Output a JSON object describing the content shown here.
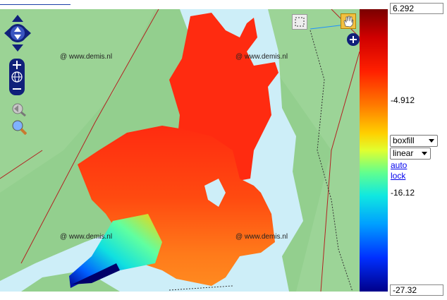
{
  "map": {
    "watermarks": [
      "@ www.demis.nl",
      "@ www.demis.nl",
      "@ www.demis.nl",
      "@ www.demis.nl"
    ],
    "tools": {
      "pan": "pan-arrows-icon",
      "zoom_in": "zoom-in-icon",
      "globe": "globe-icon",
      "zoom_out": "zoom-out-icon",
      "back": "back-arrow-icon",
      "zoom_box": "magnifier-icon",
      "select": "select-box-icon",
      "hand": "hand-icon",
      "expand": "plus-icon"
    }
  },
  "colorbar": {
    "max": "6.292",
    "tick1": "-4.912",
    "tick2": "-16.12",
    "min": "-27.32",
    "style_select": "boxfill",
    "scale_select": "linear",
    "auto_link": "auto",
    "lock_link": "lock"
  },
  "colors": {
    "land": "#93cf8e",
    "water": "#cdeef8",
    "boundary": "#b22222",
    "link": "#0000ee"
  }
}
